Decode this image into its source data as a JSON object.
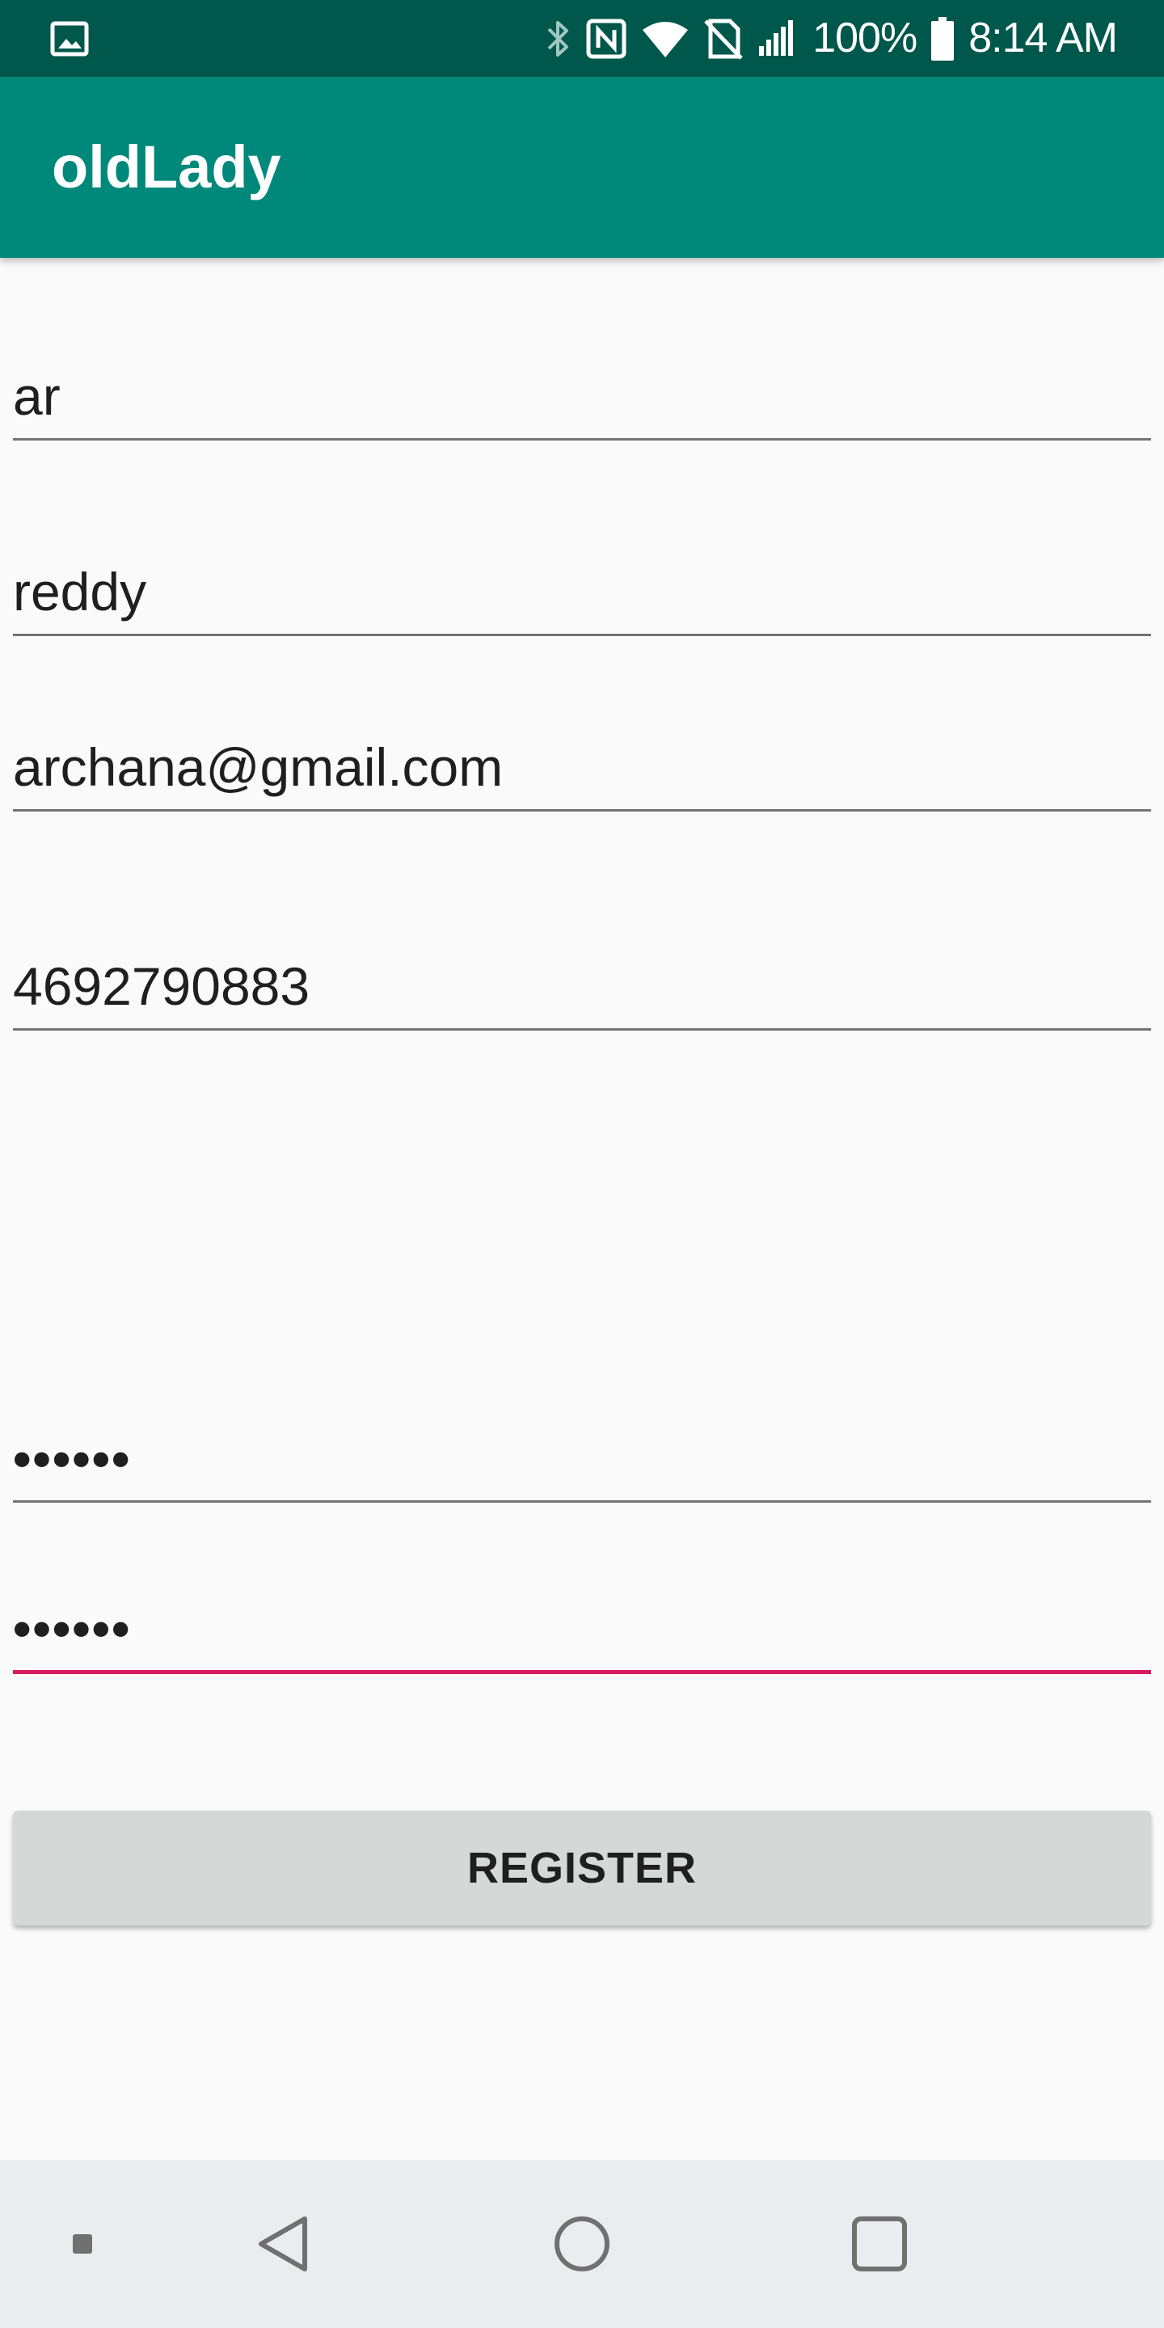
{
  "status_bar": {
    "battery_text": "100%",
    "time": "8:14 AM",
    "icons": [
      "gallery-icon",
      "bluetooth-icon",
      "nfc-icon",
      "wifi-icon",
      "no-sim-icon",
      "signal-icon",
      "battery-icon"
    ]
  },
  "app_bar": {
    "title": "oldLady"
  },
  "form": {
    "first_name_value": "ar",
    "last_name_value": "reddy",
    "email_value": "archana@gmail.com",
    "phone_value": "4692790883",
    "password_value": "••••••",
    "confirm_password_value": "••••••",
    "register_label": "REGISTER"
  },
  "colors": {
    "status_bar": "#00574b",
    "app_bar": "#00897b",
    "accent": "#d81b60",
    "button": "#d6d7d7"
  },
  "nav_bar": {
    "icons": [
      "square-dot-icon",
      "back-icon",
      "home-icon",
      "recents-icon"
    ]
  }
}
